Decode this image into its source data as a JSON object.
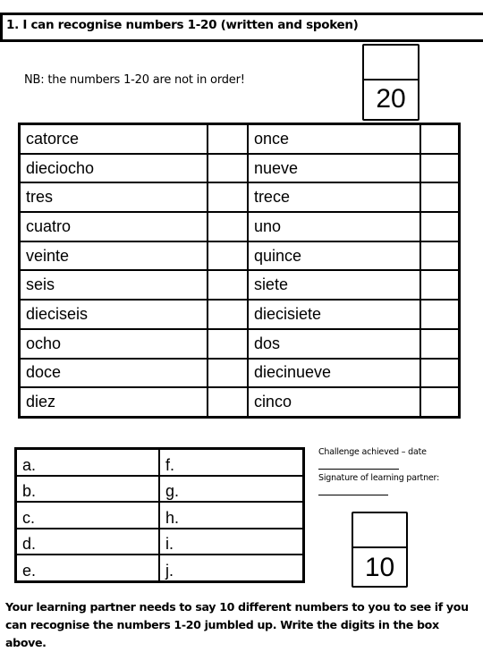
{
  "header": {
    "title": "1.  I can recognise numbers 1-20 (written and spoken)"
  },
  "note": "NB: the numbers 1-20 are not in order!",
  "score_box_main": {
    "value": "20"
  },
  "main_table": {
    "rows": [
      [
        "catorce",
        "once"
      ],
      [
        "dieciocho",
        "nueve"
      ],
      [
        "tres",
        "trece"
      ],
      [
        "cuatro",
        "uno"
      ],
      [
        "veinte",
        "quince"
      ],
      [
        "seis",
        "siete"
      ],
      [
        "dieciseis",
        "diecisiete"
      ],
      [
        "ocho",
        "dos"
      ],
      [
        "doce",
        "diecinueve"
      ],
      [
        "diez",
        "cinco"
      ]
    ]
  },
  "answer_table": {
    "rows": [
      [
        "a.",
        "f."
      ],
      [
        "b.",
        "g."
      ],
      [
        "c.",
        "h."
      ],
      [
        "d.",
        "i."
      ],
      [
        "e.",
        "j."
      ]
    ]
  },
  "challenge": {
    "date_label": "Challenge  achieved – date",
    "signature_label": "Signature of learning partner:"
  },
  "score_box_challenge": {
    "value": "10"
  },
  "footer": {
    "instructions": "Your learning partner needs to say 10 different numbers to you to see if you can recognise the numbers 1-20 jumbled up.  Write the digits in the box above."
  }
}
